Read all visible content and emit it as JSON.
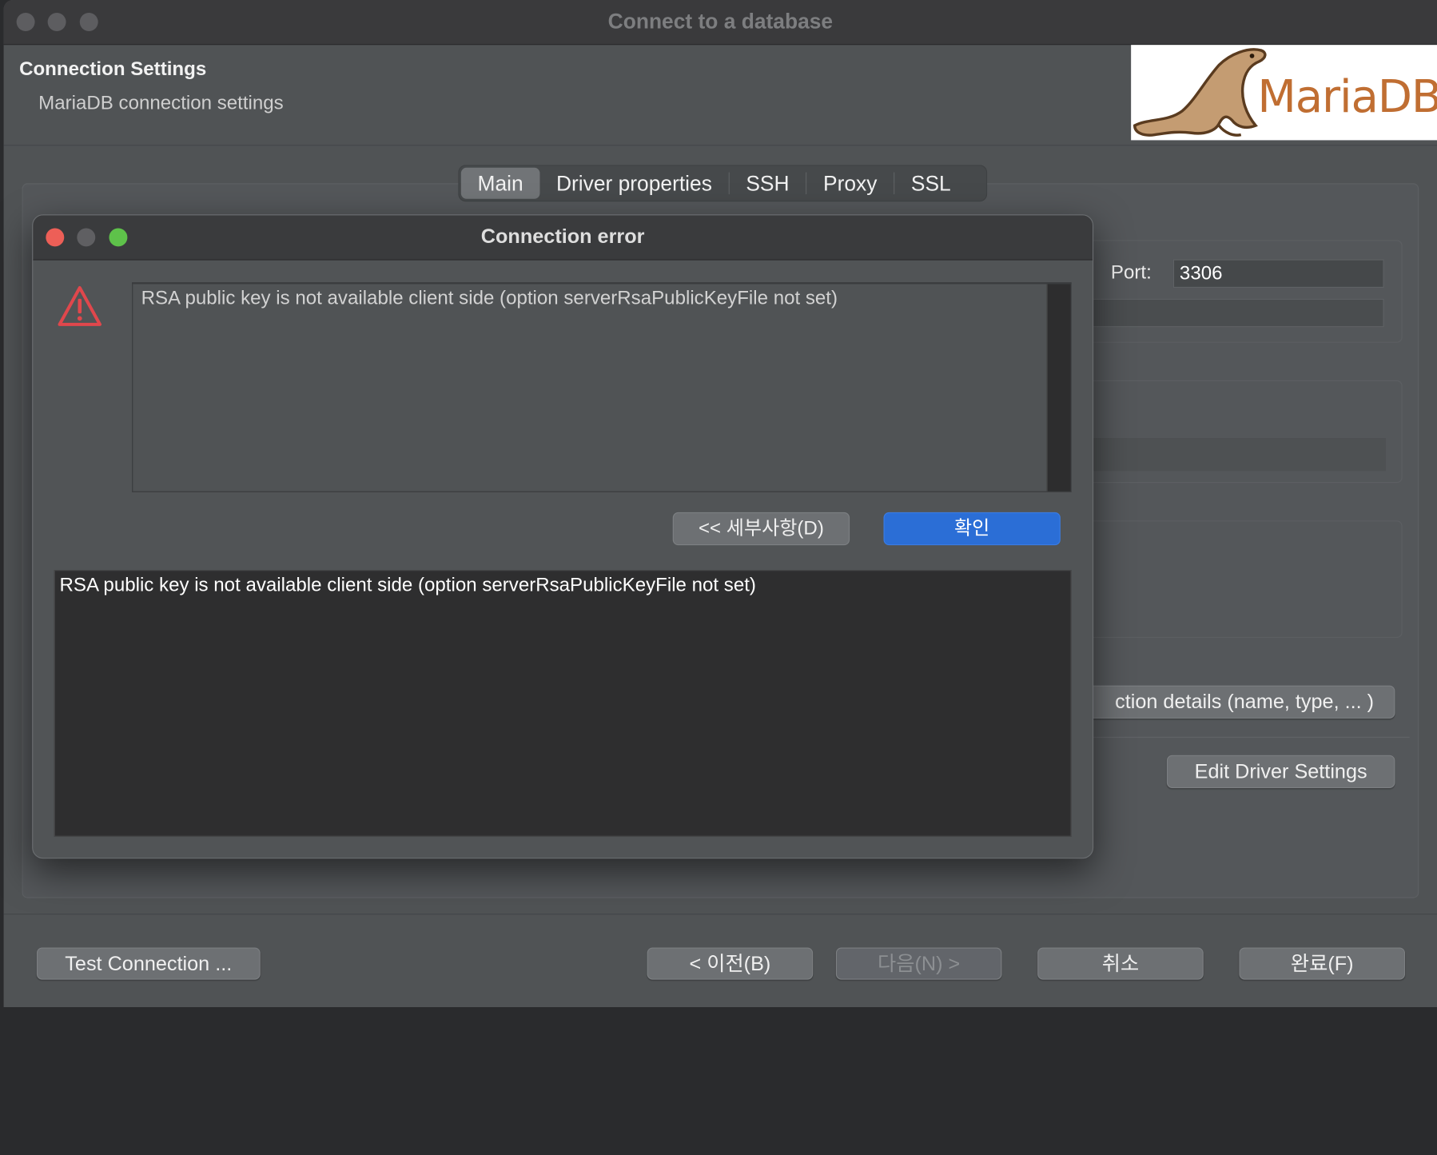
{
  "window": {
    "title": "Connect to a database"
  },
  "header": {
    "title": "Connection Settings",
    "subtitle": "MariaDB connection settings",
    "logo_text": "MariaDB"
  },
  "tabs": [
    {
      "label": "Main",
      "active": true
    },
    {
      "label": "Driver properties",
      "active": false
    },
    {
      "label": "SSH",
      "active": false
    },
    {
      "label": "Proxy",
      "active": false
    },
    {
      "label": "SSL",
      "active": false
    }
  ],
  "main": {
    "port_label": "Port:",
    "port_value": "3306",
    "connection_details_label": "ction details (name, type, ... )",
    "edit_driver_label": "Edit Driver Settings"
  },
  "dialog": {
    "title": "Connection error",
    "message": "RSA public key is not available client side (option serverRsaPublicKeyFile not set)",
    "details_button": "<< 세부사항(D)",
    "ok_button": "확인",
    "detail_text": "RSA public key is not available client side (option serverRsaPublicKeyFile not set)"
  },
  "footer": {
    "test_connection": "Test Connection ...",
    "back": "< 이전(B)",
    "next": "다음(N) >",
    "cancel": "취소",
    "finish": "완료(F)"
  },
  "colors": {
    "close": "#ed5f57",
    "minimize": "#5f5f62",
    "zoom": "#5ec24a",
    "primary_button": "#2b6ed6",
    "warning": "#e0474c",
    "logo_accent": "#c06e32"
  }
}
